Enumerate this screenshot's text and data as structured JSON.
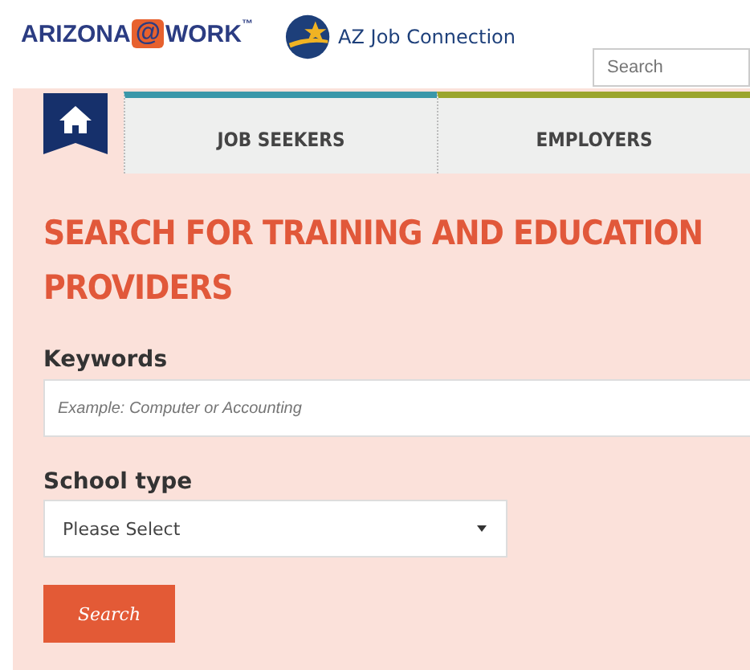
{
  "header": {
    "logo": {
      "left": "ARIZONA",
      "at": "@",
      "right": "WORK",
      "mark": "™"
    },
    "partner": "AZ Job Connection",
    "search": {
      "placeholder": "Search"
    }
  },
  "nav": {
    "tabs": [
      {
        "label": "JOB SEEKERS",
        "selected": false
      },
      {
        "label": "EMPLOYERS",
        "selected": false
      }
    ]
  },
  "title": "SEARCH FOR TRAINING AND EDUCATION PROVIDERS",
  "form": {
    "keywords": {
      "label": "Keywords",
      "placeholder": "Example: Computer or Accounting"
    },
    "school_type": {
      "label": "School type",
      "value": "Please Select"
    },
    "button": "Search"
  }
}
